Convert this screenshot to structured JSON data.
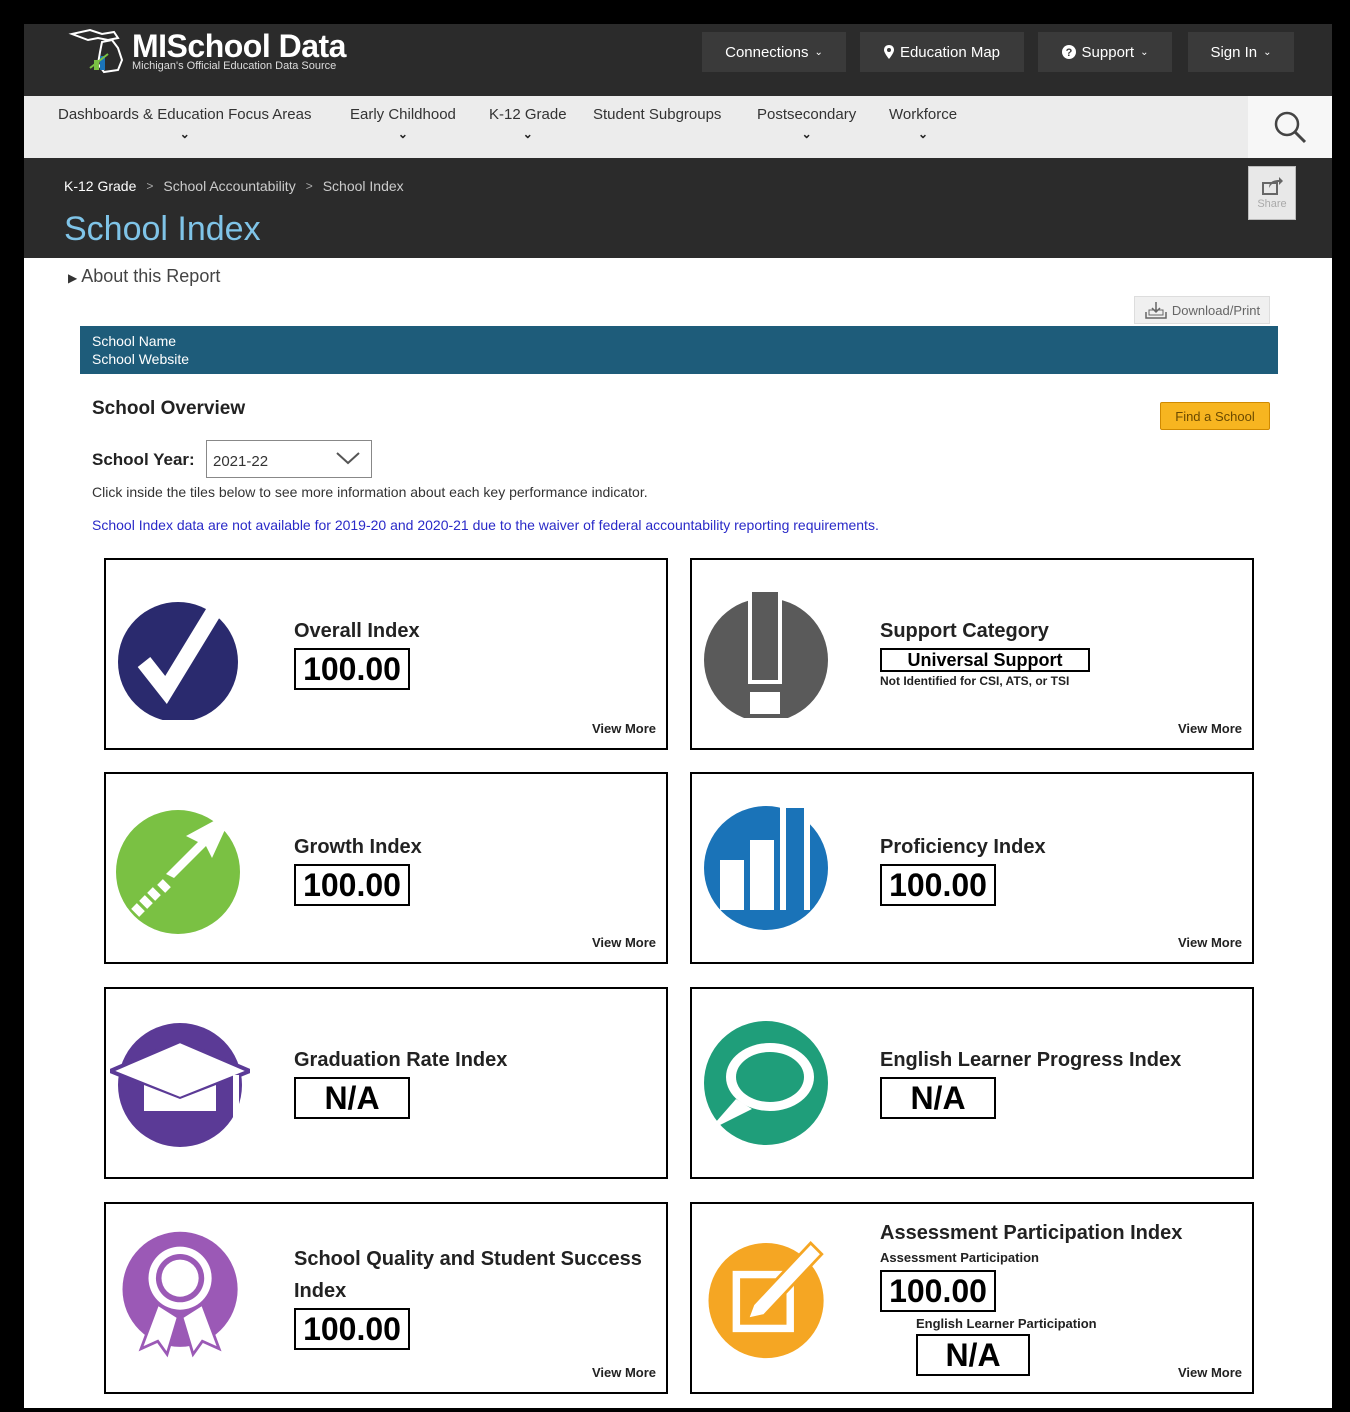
{
  "header": {
    "logo_title": "MISchool Data",
    "logo_subtitle": "Michigan's Official Education Data Source",
    "nav": [
      {
        "label": "Connections",
        "has_dropdown": true
      },
      {
        "label": "Education Map",
        "icon": "map-pin-icon"
      },
      {
        "label": "Support",
        "icon": "question-circle-icon",
        "has_dropdown": true
      },
      {
        "label": "Sign In",
        "has_dropdown": true
      }
    ]
  },
  "main_nav": {
    "items": [
      {
        "label": "Dashboards & Education Focus Areas"
      },
      {
        "label": "Early Childhood"
      },
      {
        "label": "K-12 Grade"
      },
      {
        "label": "Student Subgroups"
      },
      {
        "label": "Postsecondary"
      },
      {
        "label": "Workforce"
      }
    ]
  },
  "breadcrumb": [
    "K-12 Grade",
    "School Accountability",
    "School Index"
  ],
  "page_title": "School Index",
  "share_label": "Share",
  "about_label": "About this Report",
  "download_label": "Download/Print",
  "school_bar": {
    "name": "School Name",
    "website": "School Website"
  },
  "overview": {
    "title": "School Overview",
    "find_school_label": "Find a School",
    "year_label": "School Year:",
    "year_value": "2021-22",
    "hint": "Click inside the tiles below to see more information about each key performance indicator.",
    "notice": "School Index data are not available for 2019-20 and 2020-21 due to the waiver of federal accountability reporting requirements."
  },
  "tiles": {
    "view_more": "View More",
    "overall": {
      "title": "Overall Index",
      "value": "100.00",
      "color": "#2a2a6e"
    },
    "support": {
      "title": "Support Category",
      "value": "Universal Support",
      "note": "Not Identified for CSI, ATS, or TSI",
      "color": "#5a5a5a"
    },
    "growth": {
      "title": "Growth Index",
      "value": "100.00",
      "color": "#7ac143"
    },
    "proficiency": {
      "title": "Proficiency Index",
      "value": "100.00",
      "color": "#1a73b8"
    },
    "graduation": {
      "title": "Graduation Rate Index",
      "value": "N/A",
      "color": "#5b3a96"
    },
    "english": {
      "title": "English Learner Progress Index",
      "value": "N/A",
      "color": "#1f9e7a"
    },
    "quality": {
      "title": "School Quality and Student Success",
      "title2": "Index",
      "value": "100.00",
      "color": "#9b59b6"
    },
    "assessment": {
      "title": "Assessment Participation Index",
      "sub1": "Assessment Participation",
      "value1": "100.00",
      "sub2": "English Learner Participation",
      "value2": "N/A",
      "color": "#f5a623"
    }
  }
}
